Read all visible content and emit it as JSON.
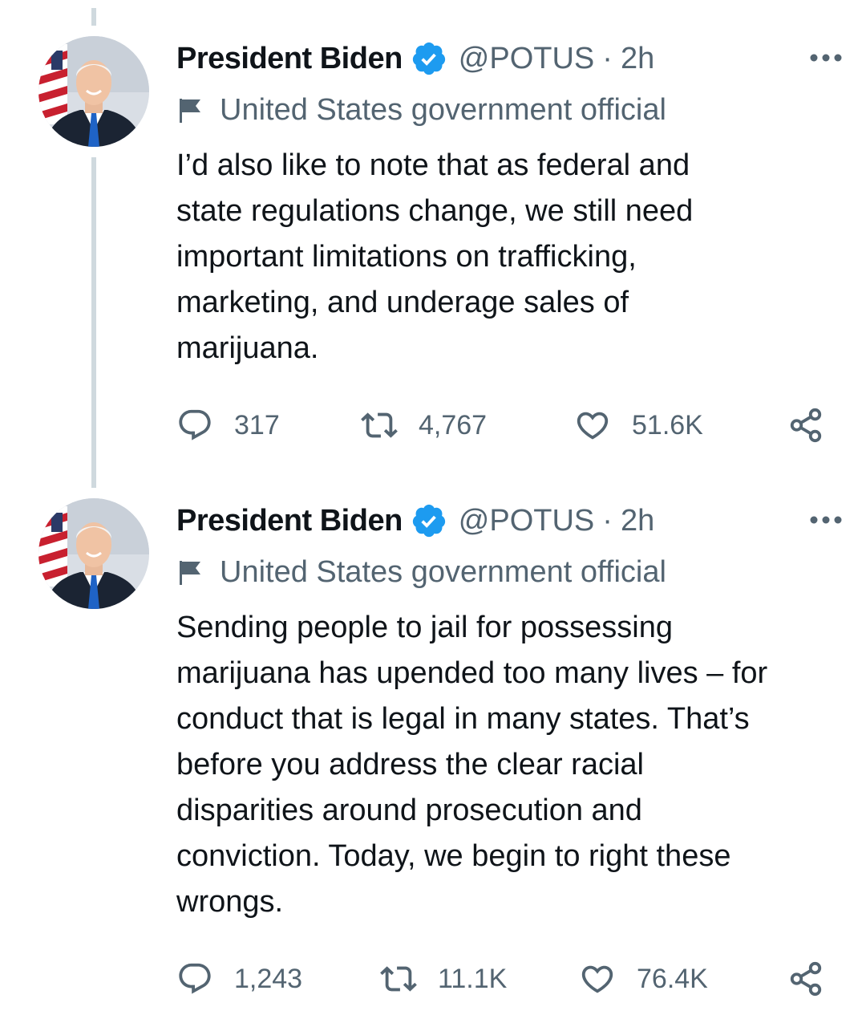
{
  "colors": {
    "verified_blue": "#1d9bf0",
    "secondary_text": "#536471",
    "primary_text": "#0f1419",
    "thread_line": "#cfd9de"
  },
  "tweets": [
    {
      "author": {
        "name": "President Biden",
        "verified_icon": "verified-badge-icon",
        "handle": "@POTUS",
        "separator": "·",
        "time": "2h"
      },
      "affiliation_icon": "flag-icon",
      "affiliation": "United States government official",
      "text_lines": [
        "I’d also like to note that as federal and",
        "state regulations change, we still need",
        "important limitations on trafficking,",
        "marketing, and underage sales of",
        "marijuana."
      ],
      "actions": {
        "reply_icon": "reply-icon",
        "replies": "317",
        "retweet_icon": "retweet-icon",
        "retweets": "4,767",
        "like_icon": "heart-icon",
        "likes": "51.6K",
        "share_icon": "share-icon"
      }
    },
    {
      "author": {
        "name": "President Biden",
        "verified_icon": "verified-badge-icon",
        "handle": "@POTUS",
        "separator": "·",
        "time": "2h"
      },
      "affiliation_icon": "flag-icon",
      "affiliation": "United States government official",
      "text_lines": [
        "Sending people to jail for possessing",
        "marijuana has upended too many lives – for",
        "conduct that is legal in many states. That’s",
        "before you address the clear racial",
        "disparities around prosecution and",
        "conviction. Today, we begin to right these",
        "wrongs."
      ],
      "actions": {
        "reply_icon": "reply-icon",
        "replies": "1,243",
        "retweet_icon": "retweet-icon",
        "retweets": "11.1K",
        "like_icon": "heart-icon",
        "likes": "76.4K",
        "share_icon": "share-icon"
      }
    }
  ]
}
